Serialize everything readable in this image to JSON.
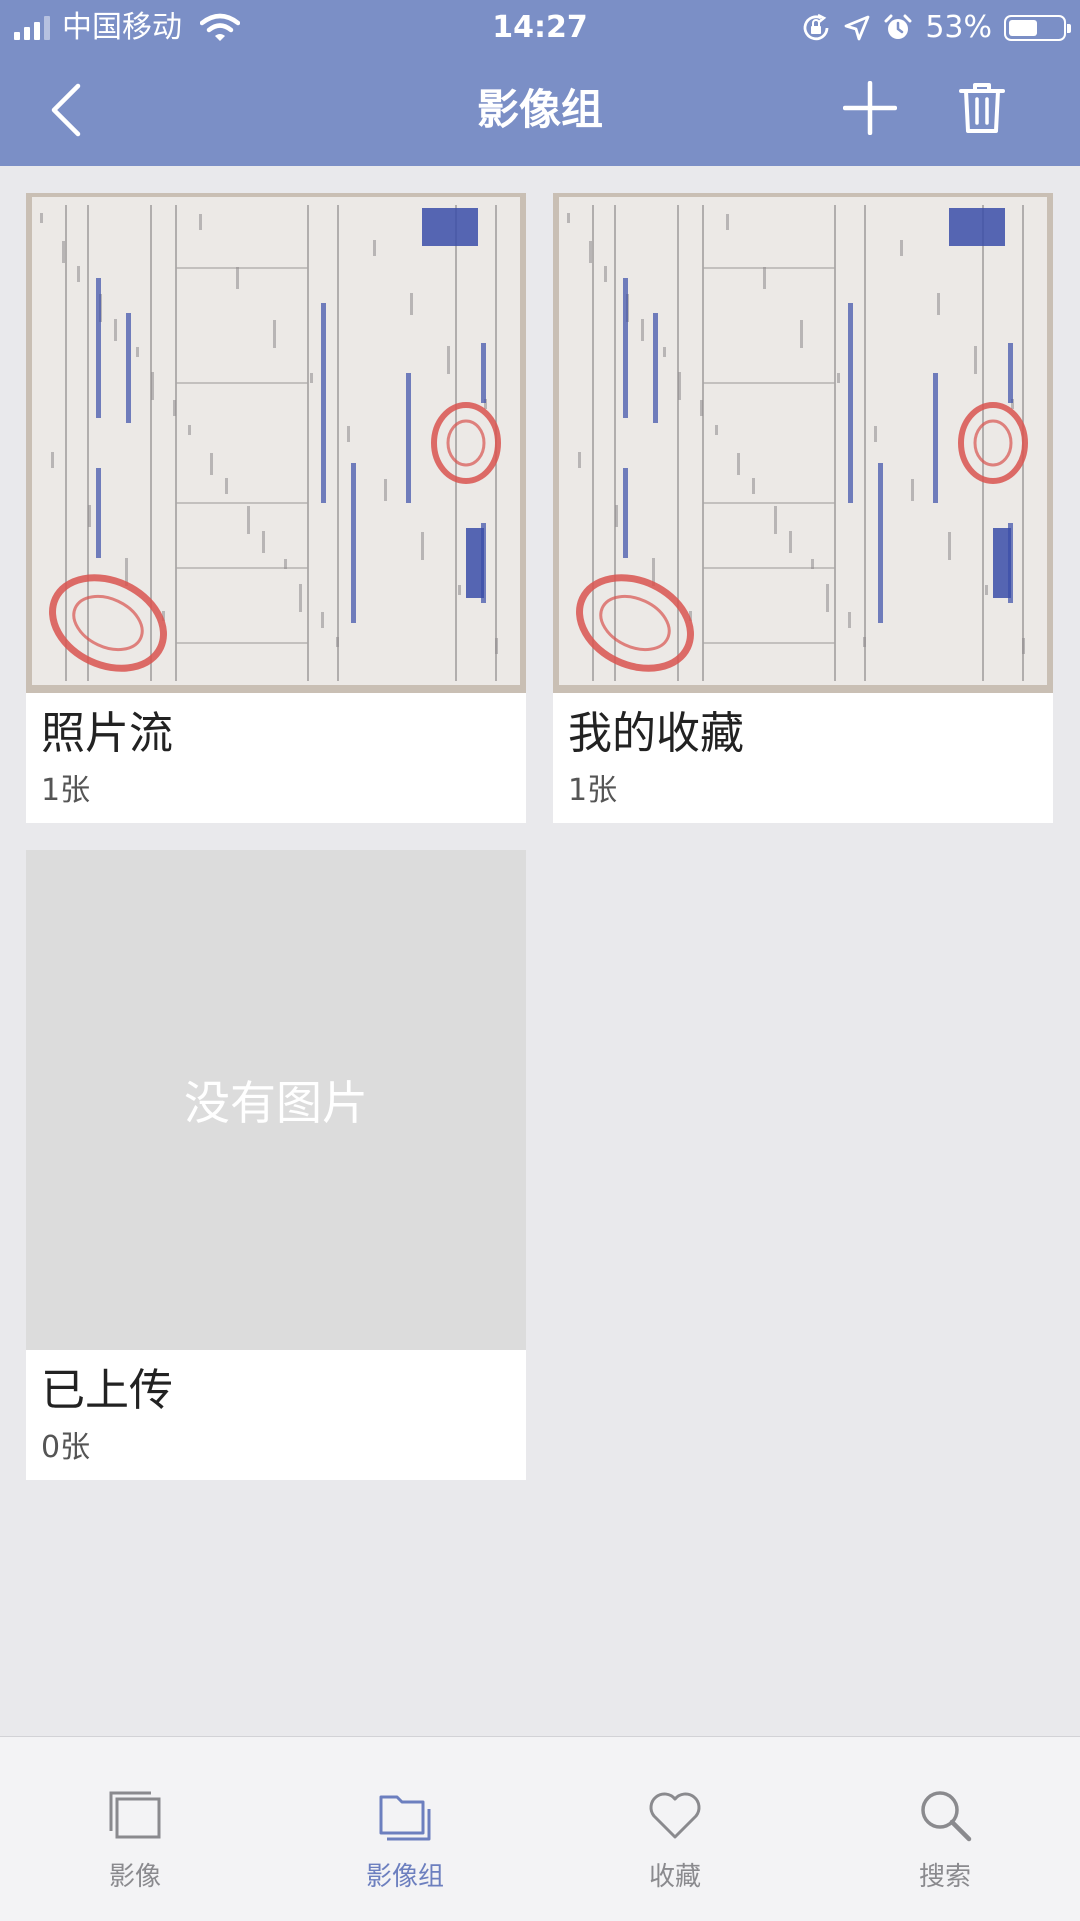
{
  "status_bar": {
    "carrier": "中国移动",
    "time": "14:27",
    "battery_percent_label": "53%",
    "battery_level": 0.53,
    "icons": [
      "signal-icon",
      "wifi-icon",
      "orientation-lock-icon",
      "location-icon",
      "alarm-icon",
      "battery-icon"
    ]
  },
  "nav": {
    "title": "影像组",
    "icons": {
      "back": "chevron-left-icon",
      "add": "plus-icon",
      "delete": "trash-icon"
    }
  },
  "albums": [
    {
      "name": "照片流",
      "count": "1张",
      "has_image": true
    },
    {
      "name": "我的收藏",
      "count": "1张",
      "has_image": true
    },
    {
      "name": "已上传",
      "count": "0张",
      "has_image": false,
      "empty_text": "没有图片"
    }
  ],
  "tabs": [
    {
      "label": "影像",
      "icon": "photos-stack-icon",
      "active": false
    },
    {
      "label": "影像组",
      "icon": "folder-icon",
      "active": true
    },
    {
      "label": "收藏",
      "icon": "heart-icon",
      "active": false
    },
    {
      "label": "搜索",
      "icon": "search-icon",
      "active": false
    }
  ],
  "colors": {
    "header_bg": "#7b8fc6",
    "page_bg": "#e9e9ec",
    "tab_active": "#6c7fbf",
    "tab_inactive": "#8a8a8e",
    "stamp_red": "#d9534f",
    "ink_blue": "#3b4da8"
  }
}
